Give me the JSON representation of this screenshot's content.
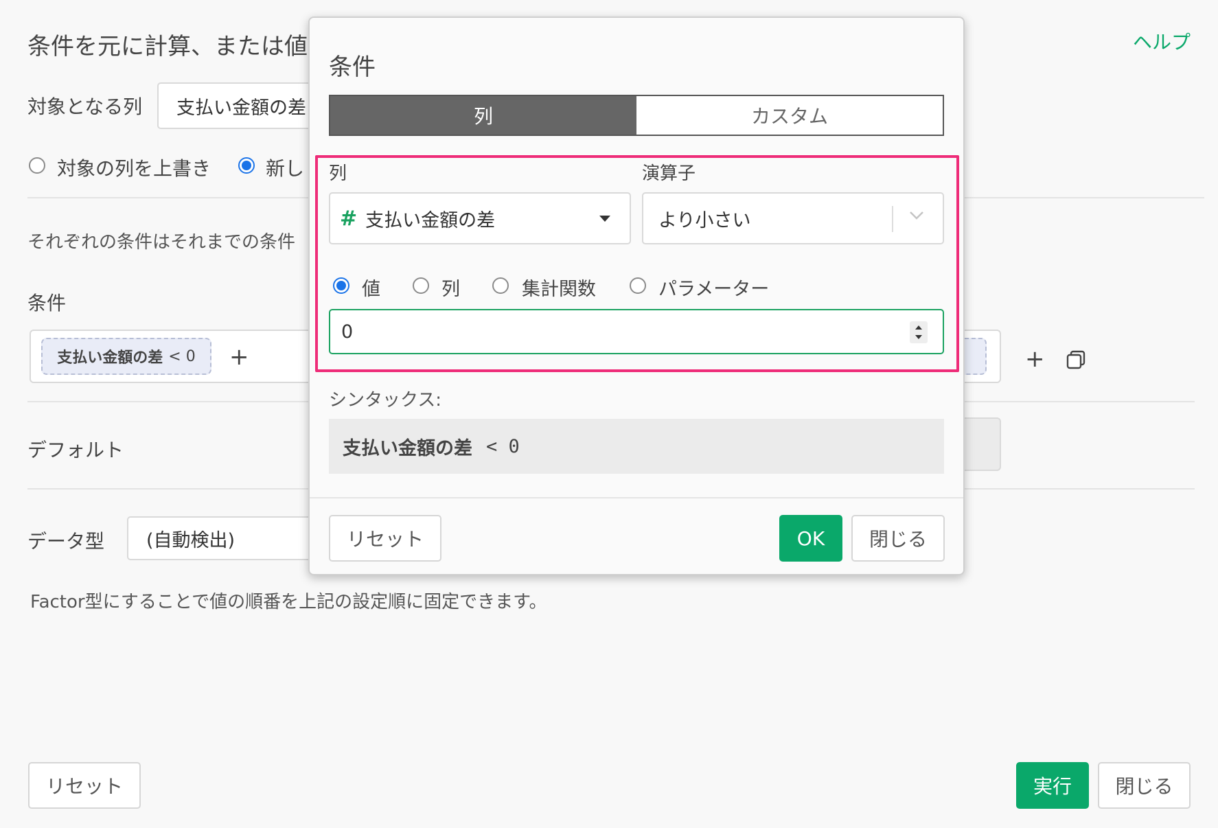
{
  "main": {
    "heading": "条件を元に計算、または値",
    "help_link": "ヘルプ",
    "target_column_label": "対象となる列",
    "target_column_value": "支払い金額の差",
    "radio_overwrite": "対象の列を上書き",
    "radio_new": "新し",
    "description": "それぞれの条件はそれまでの条件",
    "conditions_label": "条件",
    "condition_chip": "支払い金額の差",
    "condition_chip_op": "< 0",
    "default_label": "デフォルト",
    "datatype_label": "データ型",
    "datatype_value": "(自動検出)",
    "factor_note": "Factor型にすることで値の順番を上記の設定順に固定できます。",
    "reset_button": "リセット",
    "run_button": "実行",
    "close_button": "閉じる"
  },
  "dialog": {
    "title": "条件",
    "tabs": [
      "列",
      "カスタム"
    ],
    "column_label": "列",
    "column_value": "支払い金額の差",
    "operator_label": "演算子",
    "operator_value": "より小さい",
    "value_types": [
      "値",
      "列",
      "集計関数",
      "パラメーター"
    ],
    "value_input": "0",
    "syntax_label": "シンタックス:",
    "syntax_column": "支払い金額の差",
    "syntax_expr": "< 0",
    "reset_button": "リセット",
    "ok_button": "OK",
    "close_button": "閉じる"
  },
  "colors": {
    "accent_green": "#0aa86a",
    "highlight_pink": "#ee2c78",
    "radio_blue": "#1a73e8"
  }
}
